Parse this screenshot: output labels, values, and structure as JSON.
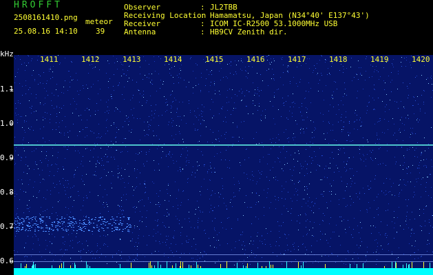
{
  "header": {
    "app_title": "HROFFT",
    "filename": "2508161410.png",
    "datetime": "25.08.16 14:10",
    "count_label": "meteor",
    "count_value": "39"
  },
  "info": [
    {
      "label": "Observer",
      "value": "JL2TBB"
    },
    {
      "label": "Receiving Location",
      "value": "Hamamatsu, Japan (N34°40' E137°43')"
    },
    {
      "label": "Receiver",
      "value": "ICOM IC-R2500 53.1000MHz USB"
    },
    {
      "label": "Antenna",
      "value": "HB9CV Zenith dir."
    }
  ],
  "axes": {
    "y_unit": "kHz",
    "y_ticks": [
      "1.1",
      "1.0",
      "0.9",
      "0.8",
      "0.7",
      "0.6"
    ],
    "x_ticks": [
      "1411",
      "1412",
      "1413",
      "1414",
      "1415",
      "1416",
      "1417",
      "1418",
      "1419",
      "1420"
    ]
  },
  "colors": {
    "background": "#000000",
    "plot_bg": "#061466",
    "title_green": "#33cc33",
    "info_yellow": "#ffff33",
    "noise_cyan": "#00ffff",
    "trace_cyan": "#66ffee"
  }
}
